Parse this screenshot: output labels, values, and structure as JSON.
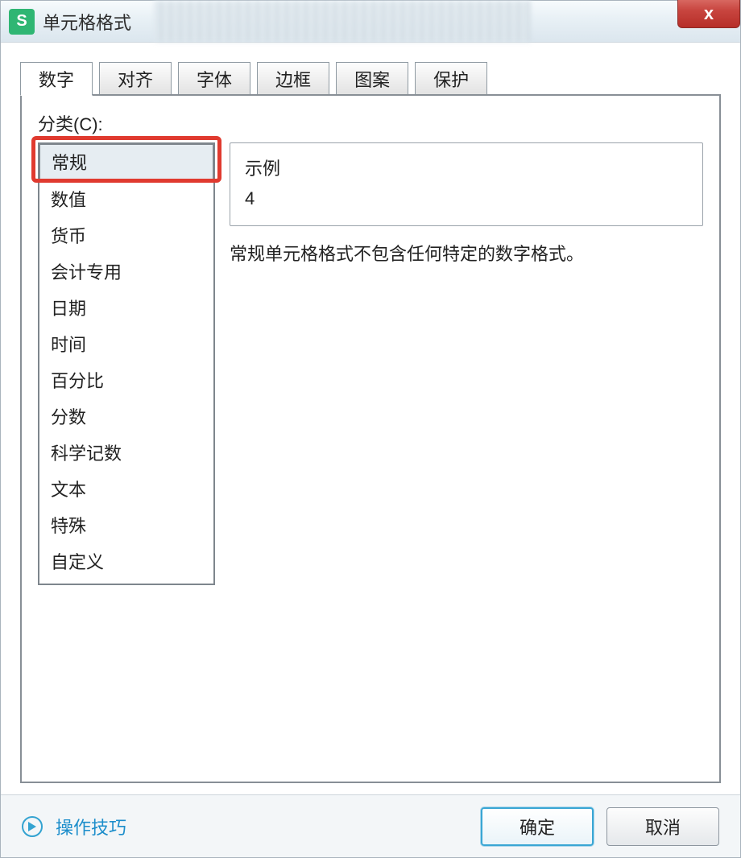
{
  "title": "单元格格式",
  "app_icon_letter": "S",
  "close_hint": "x",
  "tabs": [
    {
      "label": "数字"
    },
    {
      "label": "对齐"
    },
    {
      "label": "字体"
    },
    {
      "label": "边框"
    },
    {
      "label": "图案"
    },
    {
      "label": "保护"
    }
  ],
  "category_label": "分类(C):",
  "categories": [
    "常规",
    "数值",
    "货币",
    "会计专用",
    "日期",
    "时间",
    "百分比",
    "分数",
    "科学记数",
    "文本",
    "特殊",
    "自定义"
  ],
  "sample_title": "示例",
  "sample_value": "4",
  "description": "常规单元格格式不包含任何特定的数字格式。",
  "tips_link": "操作技巧",
  "buttons": {
    "ok": "确定",
    "cancel": "取消"
  }
}
